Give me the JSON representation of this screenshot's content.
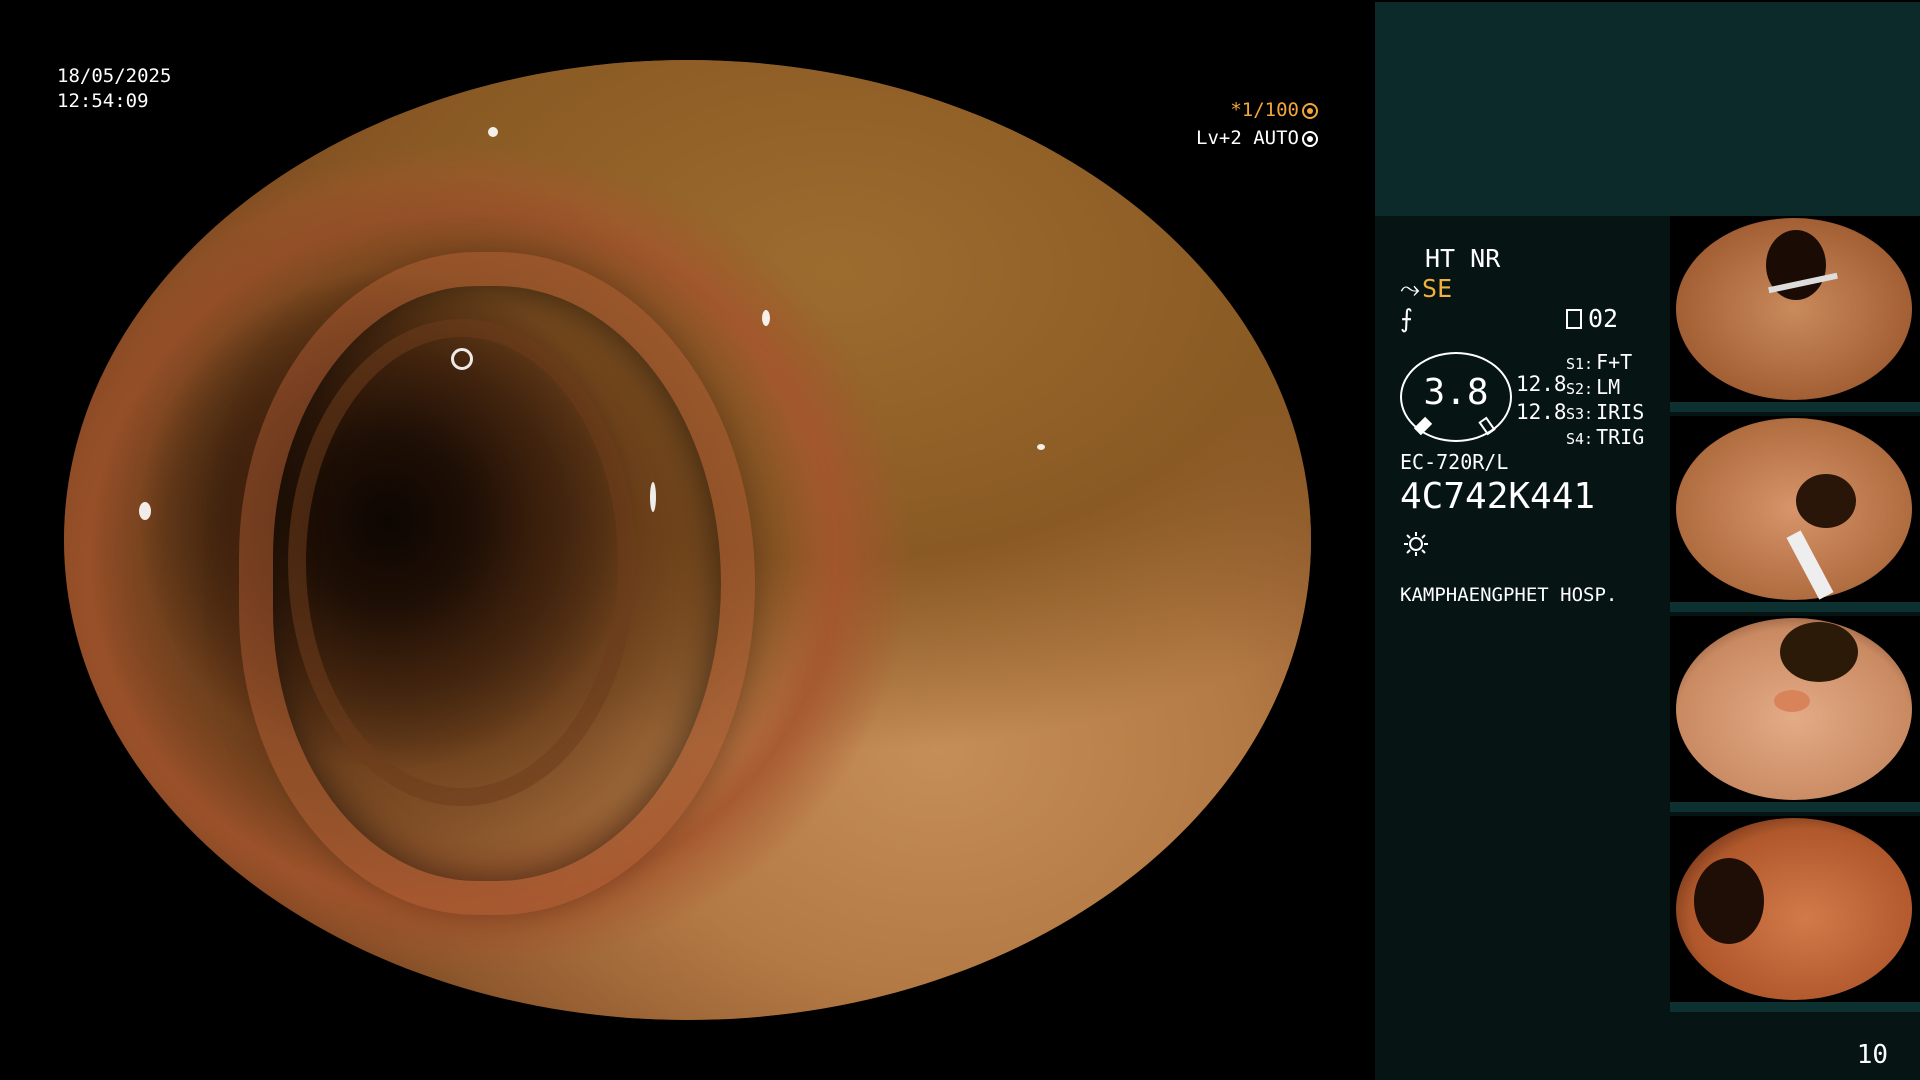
{
  "overlay": {
    "date": "18/05/2025",
    "time": "12:54:09",
    "shutter": "*1/100",
    "level": "Lv+2 AUTO"
  },
  "panel": {
    "ht_nr": "HT NR",
    "se": "SE",
    "f_glyph": "⨍",
    "rec_count": "02",
    "gauge_value": "3.8",
    "gauge_line1": "12.8",
    "gauge_line2": "12.8",
    "switches": [
      {
        "key": "S1:",
        "value": "F+T"
      },
      {
        "key": "S2:",
        "value": "LM"
      },
      {
        "key": "S3:",
        "value": "IRIS"
      },
      {
        "key": "S4:",
        "value": "TRIG"
      }
    ],
    "scope_model": "EC-720R/L",
    "scope_serial": "4C742K441",
    "hospital": "KAMPHAENGPHET HOSP."
  },
  "page_number": "10",
  "icons": [
    "shutter-icon",
    "auto-iris-icon",
    "scope-icon",
    "record-icon",
    "light-icon"
  ]
}
